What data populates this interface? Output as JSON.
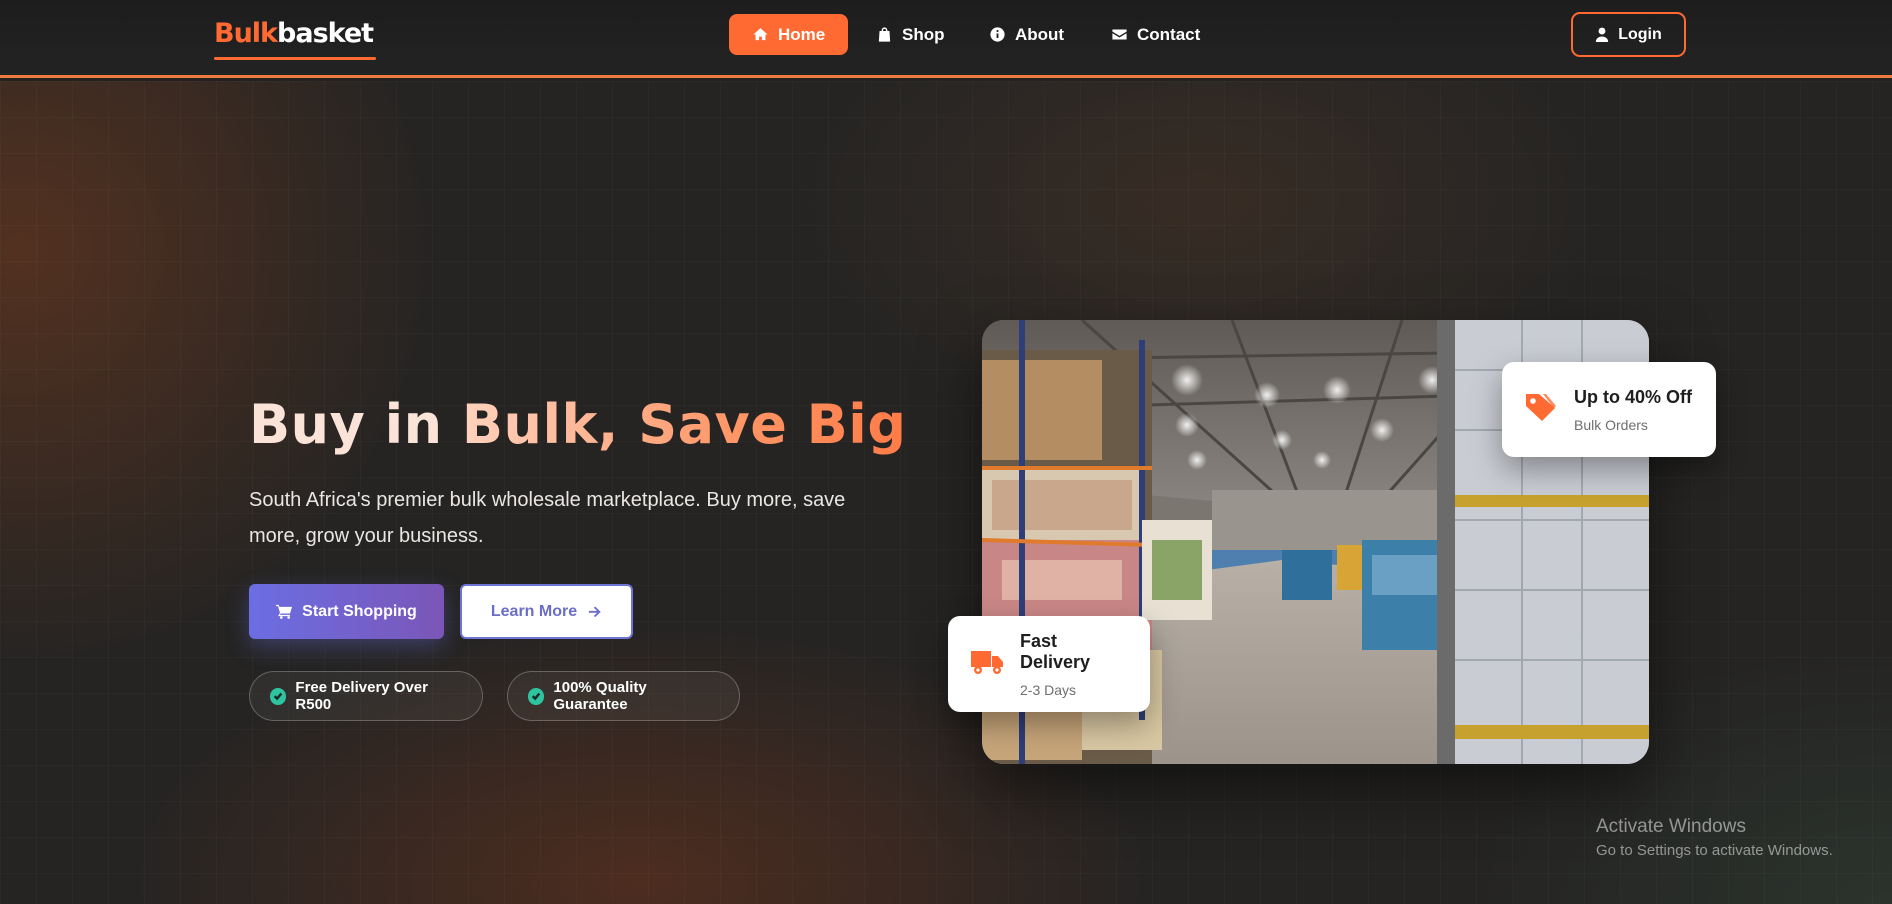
{
  "brand": {
    "part1": "Bulk",
    "part2": "basket",
    "accent": "#ff6a33"
  },
  "nav": {
    "items": [
      {
        "label": "Home",
        "icon": "home-icon",
        "active": true
      },
      {
        "label": "Shop",
        "icon": "shopping-bag-icon",
        "active": false
      },
      {
        "label": "About",
        "icon": "info-icon",
        "active": false
      },
      {
        "label": "Contact",
        "icon": "envelope-icon",
        "active": false
      }
    ],
    "login_label": "Login"
  },
  "hero": {
    "title_part1": "Buy in ",
    "title_part2": "Bulk, Save Big",
    "subtitle": "South Africa's premier bulk wholesale marketplace. Buy more, save more, grow your business.",
    "primary_button": "Start Shopping",
    "secondary_button": "Learn More",
    "features": [
      "Free Delivery Over R500",
      "100% Quality Guarantee"
    ]
  },
  "cards": {
    "discount": {
      "title": "Up to 40% Off",
      "subtitle": "Bulk Orders",
      "icon": "tag-icon"
    },
    "delivery": {
      "title": "Fast Delivery",
      "subtitle": "2-3 Days",
      "icon": "truck-icon"
    }
  },
  "image": {
    "subject": "warehouse-photo"
  },
  "watermark": {
    "line1": "Activate Windows",
    "line2": "Go to Settings to activate Windows."
  },
  "colors": {
    "accent": "#ff6a33",
    "primary_btn": "#6b6ee3",
    "check": "#2ec4a0"
  }
}
